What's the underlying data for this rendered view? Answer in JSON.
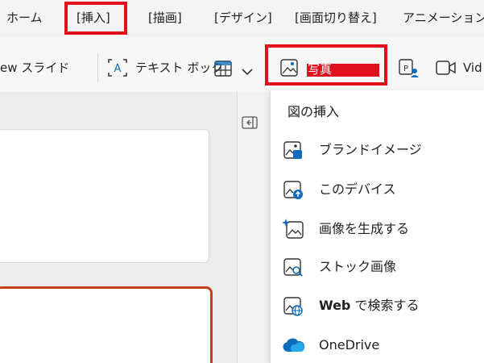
{
  "tabs": [
    {
      "label": "ホーム"
    },
    {
      "label": "[挿入]"
    },
    {
      "label": "[描画]"
    },
    {
      "label": "[デザイン]"
    },
    {
      "label": "[画面切り替え]"
    },
    {
      "label": "アニメーション"
    }
  ],
  "toolbar": {
    "new_slide_label": "ew スライド",
    "textbox_label": "テキスト ボックス",
    "picture_label": "写真",
    "video_label": "Vid"
  },
  "menu": {
    "header": "図の挿入",
    "items": [
      {
        "label": "ブランドイメージ",
        "icon": "brand-image-icon"
      },
      {
        "label": "このデバイス",
        "icon": "device-upload-icon"
      },
      {
        "label": "画像を生成する",
        "icon": "generate-image-icon"
      },
      {
        "label": "ストック画像",
        "icon": "stock-image-icon"
      },
      {
        "label_strong": "Web",
        "label_rest": " で検索する",
        "icon": "web-search-image-icon"
      },
      {
        "label": "OneDrive",
        "icon": "onedrive-icon"
      }
    ]
  },
  "colors": {
    "highlight": "#e2101c",
    "accent_blue": "#0f6cbd",
    "slide_border": "#c2401c"
  }
}
